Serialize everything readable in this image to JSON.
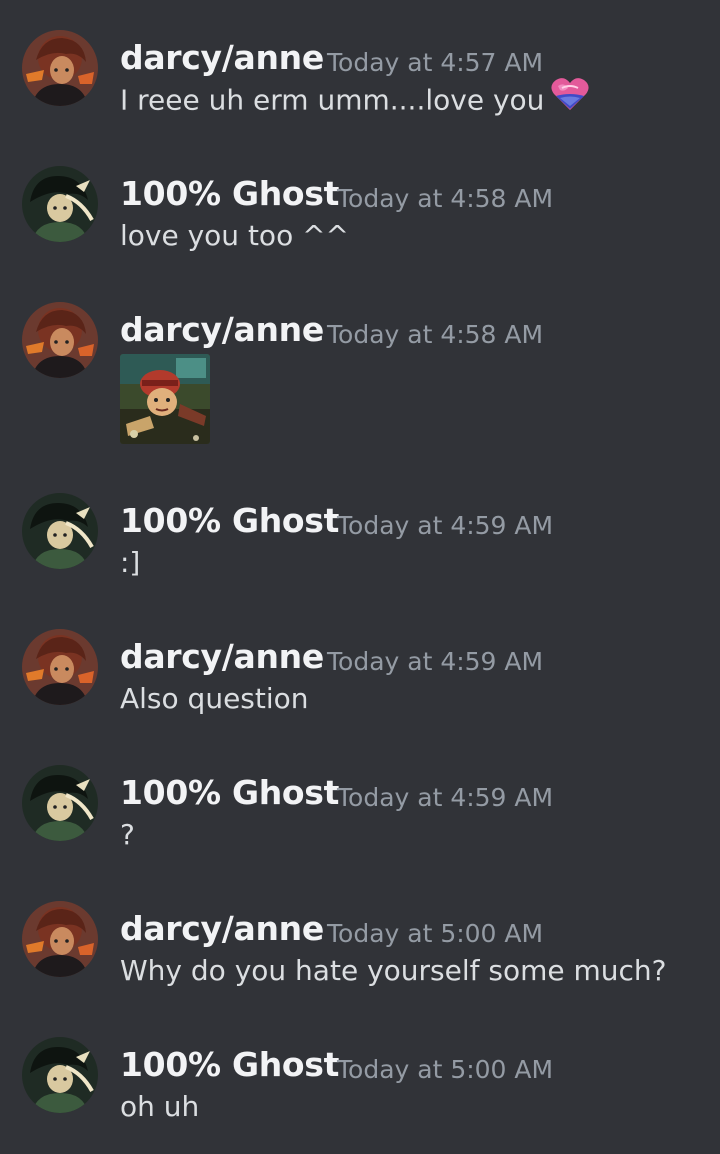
{
  "messages": [
    {
      "author": "darcy/anne",
      "timestamp": "Today at 4:57 AM",
      "text": "I reee uh erm umm....love you",
      "emoji": "heart-emoji",
      "avatar": "darcy-avatar"
    },
    {
      "author": "100% Ghost",
      "timestamp": "Today at 4:58 AM",
      "text": "love you too ^^",
      "avatar": "ghost-avatar"
    },
    {
      "author": "darcy/anne",
      "timestamp": "Today at 4:58 AM",
      "text": "",
      "attachment": "image-attachment",
      "avatar": "darcy-avatar"
    },
    {
      "author": "100% Ghost",
      "timestamp": "Today at 4:59 AM",
      "text": ":]",
      "avatar": "ghost-avatar"
    },
    {
      "author": "darcy/anne",
      "timestamp": "Today at 4:59 AM",
      "text": "Also question",
      "avatar": "darcy-avatar"
    },
    {
      "author": "100% Ghost",
      "timestamp": "Today at 4:59 AM",
      "text": "?",
      "avatar": "ghost-avatar"
    },
    {
      "author": "darcy/anne",
      "timestamp": "Today at 5:00 AM",
      "text": "Why do you hate yourself some much?",
      "avatar": "darcy-avatar"
    },
    {
      "author": "100% Ghost",
      "timestamp": "Today at 5:00 AM",
      "text": "oh uh",
      "avatar": "ghost-avatar"
    }
  ],
  "colors": {
    "background": "#313338",
    "username": "#f2f3f5",
    "timestamp": "#949ba4",
    "message_text": "#dbdee1"
  }
}
